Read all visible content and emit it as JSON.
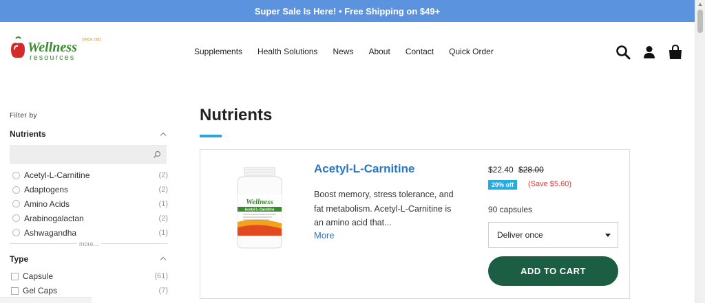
{
  "promo": {
    "text": "Super Sale Is Here! • Free Shipping on $49+"
  },
  "brand": {
    "logo_word": "Wellness",
    "logo_sub": "resources",
    "since": "SINCE 1983"
  },
  "nav": {
    "items": [
      "Supplements",
      "Health Solutions",
      "News",
      "About",
      "Contact",
      "Quick Order"
    ]
  },
  "header_icons": [
    "search-icon",
    "account-icon",
    "cart-icon"
  ],
  "sidebar": {
    "filter_by": "Filter by",
    "nutrients": {
      "title": "Nutrients",
      "search_placeholder": "",
      "items": [
        {
          "label": "Acetyl-L-Carnitine",
          "count": "(2)"
        },
        {
          "label": "Adaptogens",
          "count": "(2)"
        },
        {
          "label": "Amino Acids",
          "count": "(1)"
        },
        {
          "label": "Arabinogalactan",
          "count": "(2)"
        },
        {
          "label": "Ashwagandha",
          "count": "(1)"
        }
      ],
      "more": "more..."
    },
    "type": {
      "title": "Type",
      "items": [
        {
          "label": "Capsule",
          "count": "(61)"
        },
        {
          "label": "Gel Caps",
          "count": "(7)"
        }
      ]
    }
  },
  "main": {
    "title": "Nutrients"
  },
  "product": {
    "name": "Acetyl-L-Carnitine",
    "description": "Boost memory, stress tolerance, and fat metabolism. Acetyl-L-Carnitine is an amino acid that...",
    "more": "More",
    "price": "$22.40",
    "old_price": "$28.00",
    "discount": "20% off",
    "save": "(Save $5.60)",
    "quantity": "90 capsules",
    "deliver_select": "Deliver once",
    "add_to_cart": "ADD TO CART",
    "label_brand": "Wellness",
    "label_name": "Acetyl-L-Carnitine"
  },
  "colors": {
    "promo_bg": "#5b93de",
    "accent_blue": "#2a74c0",
    "cart_green": "#1c5e44",
    "badge_blue": "#29abe2",
    "save_red": "#d43a3a"
  }
}
